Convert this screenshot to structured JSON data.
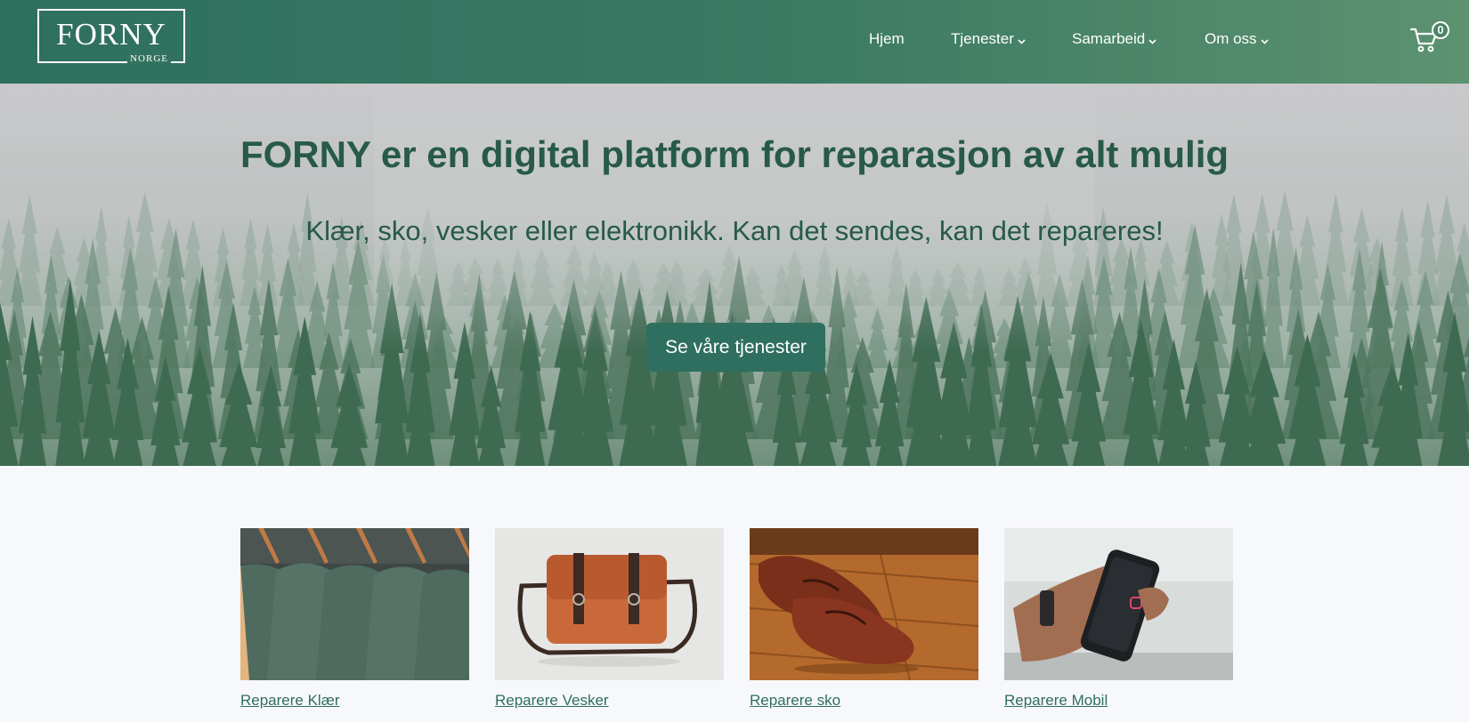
{
  "header": {
    "logo": {
      "main": "FORNY",
      "sub": "NORGE"
    },
    "nav": [
      {
        "label": "Hjem",
        "dropdown": false
      },
      {
        "label": "Tjenester",
        "dropdown": true
      },
      {
        "label": "Samarbeid",
        "dropdown": true
      },
      {
        "label": "Om oss",
        "dropdown": true
      }
    ],
    "cart": {
      "icon": "cart-icon",
      "count": "0"
    }
  },
  "hero": {
    "title": "FORNY er en digital platform for reparasjon av alt mulig",
    "subtitle": "Klær, sko, vesker eller elektronikk. Kan det sendes, kan det repareres!",
    "button_label": "Se våre tjenester"
  },
  "services": [
    {
      "label": "Reparere Klær",
      "image": "clothes-on-hangers-image"
    },
    {
      "label": "Reparere Vesker",
      "image": "leather-bag-image"
    },
    {
      "label": "Reparere sko",
      "image": "leather-shoes-image"
    },
    {
      "label": "Reparere Mobil",
      "image": "mobile-phone-image"
    }
  ],
  "colors": {
    "brand_green": "#2f6f5f",
    "header_gradient_end": "#5c9270",
    "text_green": "#275a47",
    "page_bg": "#f7f8fb"
  }
}
